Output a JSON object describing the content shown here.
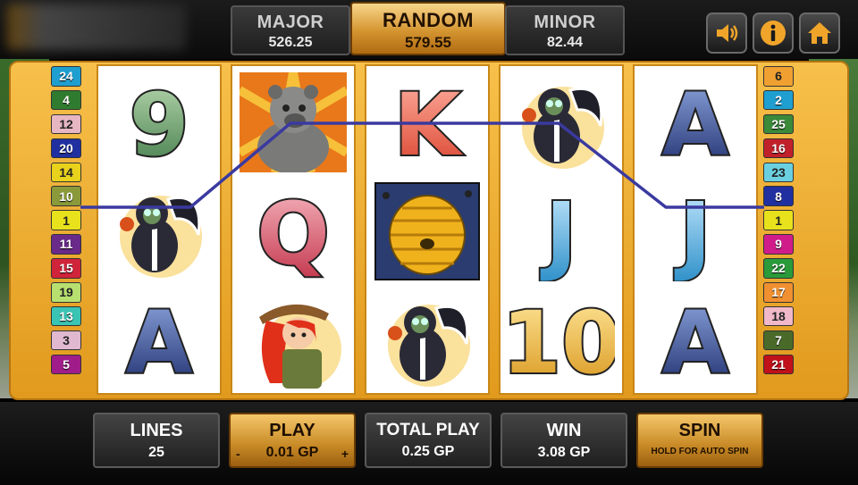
{
  "jackpots": {
    "major": {
      "title": "MAJOR",
      "value": "526.25"
    },
    "random": {
      "title": "RANDOM",
      "value": "579.55"
    },
    "minor": {
      "title": "MINOR",
      "value": "82.44"
    }
  },
  "header_icons": [
    "speaker-icon",
    "info-icon",
    "home-icon"
  ],
  "paylines_left": [
    {
      "n": "24",
      "color": "#1f9fd0"
    },
    {
      "n": "4",
      "color": "#2f7b2f"
    },
    {
      "n": "12",
      "color": "#e7b6c3"
    },
    {
      "n": "20",
      "color": "#2030a0"
    },
    {
      "n": "14",
      "color": "#e8d21c"
    },
    {
      "n": "10",
      "color": "#8a9a3a"
    },
    {
      "n": "1",
      "color": "#e8e21c"
    },
    {
      "n": "11",
      "color": "#6a2a8a"
    },
    {
      "n": "15",
      "color": "#d0243a"
    },
    {
      "n": "19",
      "color": "#b8e070"
    },
    {
      "n": "13",
      "color": "#3ac4b4"
    },
    {
      "n": "3",
      "color": "#e0b8d0"
    },
    {
      "n": "5",
      "color": "#a01c8a"
    }
  ],
  "paylines_right": [
    {
      "n": "6",
      "color": "#f0a030"
    },
    {
      "n": "2",
      "color": "#1f9fd0"
    },
    {
      "n": "25",
      "color": "#3a8a3a"
    },
    {
      "n": "16",
      "color": "#c0202a"
    },
    {
      "n": "23",
      "color": "#6ad0e0"
    },
    {
      "n": "8",
      "color": "#2030a0"
    },
    {
      "n": "1",
      "color": "#e8e21c"
    },
    {
      "n": "9",
      "color": "#d01c8a"
    },
    {
      "n": "22",
      "color": "#2a9a3a"
    },
    {
      "n": "17",
      "color": "#f09030"
    },
    {
      "n": "18",
      "color": "#f0b8c8"
    },
    {
      "n": "7",
      "color": "#4a6a2a"
    },
    {
      "n": "21",
      "color": "#c0101a"
    }
  ],
  "reels": [
    [
      "nine",
      "skunk",
      "ace"
    ],
    [
      "bear",
      "queen",
      "ranger-girl"
    ],
    [
      "king",
      "beehive",
      "skunk"
    ],
    [
      "skunk",
      "jack",
      "ten"
    ],
    [
      "ace",
      "jack",
      "ace"
    ]
  ],
  "winning_payline_color": "#3a3aa0",
  "controls": {
    "lines": {
      "title": "LINES",
      "value": "25"
    },
    "play": {
      "title": "PLAY",
      "value": "0.01 GP",
      "minus": "-",
      "plus": "+"
    },
    "total_play": {
      "title": "TOTAL PLAY",
      "value": "0.25 GP"
    },
    "win": {
      "title": "WIN",
      "value": "3.08 GP"
    },
    "spin": {
      "title": "SPIN",
      "subtitle": "HOLD FOR AUTO SPIN"
    }
  }
}
